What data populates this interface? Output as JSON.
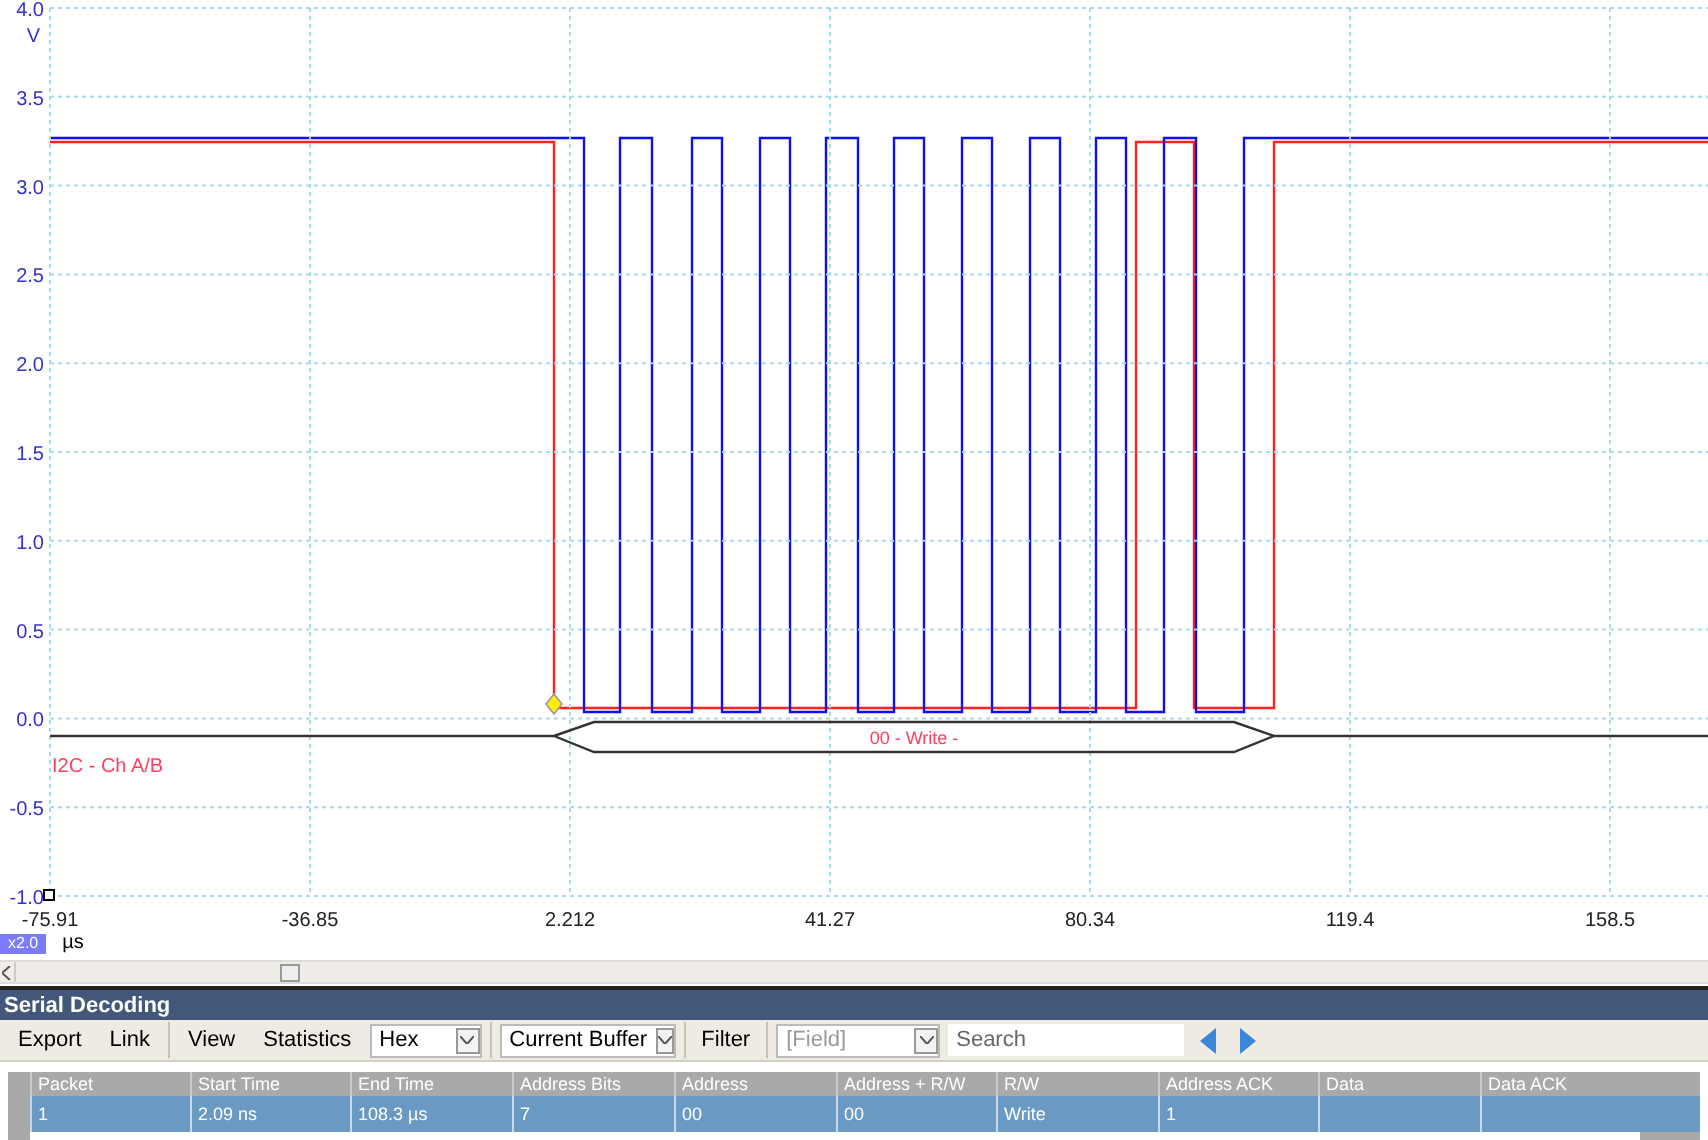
{
  "plot": {
    "y_unit": "V",
    "y_ticks": [
      "4.0",
      "3.5",
      "3.0",
      "2.5",
      "2.0",
      "1.5",
      "1.0",
      "0.5",
      "0.0",
      "-0.5",
      "-1.0"
    ],
    "x_ticks": [
      "-75.91",
      "-36.85",
      "2.212",
      "41.27",
      "80.34",
      "119.4",
      "158.5"
    ],
    "x_unit": "µs",
    "zoom_badge": "x2.0",
    "decode_label": "I2C - Ch A/B",
    "decode_packet": "00 - Write -"
  },
  "panel": {
    "title": "Serial Decoding",
    "toolbar": {
      "buttons": [
        "Export",
        "Link",
        "View",
        "Statistics"
      ],
      "format_select": "Hex",
      "buffer_select": "Current Buffer",
      "filter_label": "Filter",
      "field_select": {
        "placeholder": "[Field]"
      },
      "search": {
        "placeholder": "Search"
      }
    }
  },
  "table": {
    "columns": [
      "Packet",
      "Start Time",
      "End Time",
      "Address Bits",
      "Address",
      "Address + R/W",
      "R/W",
      "Address ACK",
      "Data",
      "Data ACK"
    ],
    "rows": [
      {
        "selected": true,
        "cells": [
          "1",
          "2.09 ns",
          "108.3 µs",
          "7",
          "00",
          "00",
          "Write",
          "1"
        ]
      }
    ]
  }
}
